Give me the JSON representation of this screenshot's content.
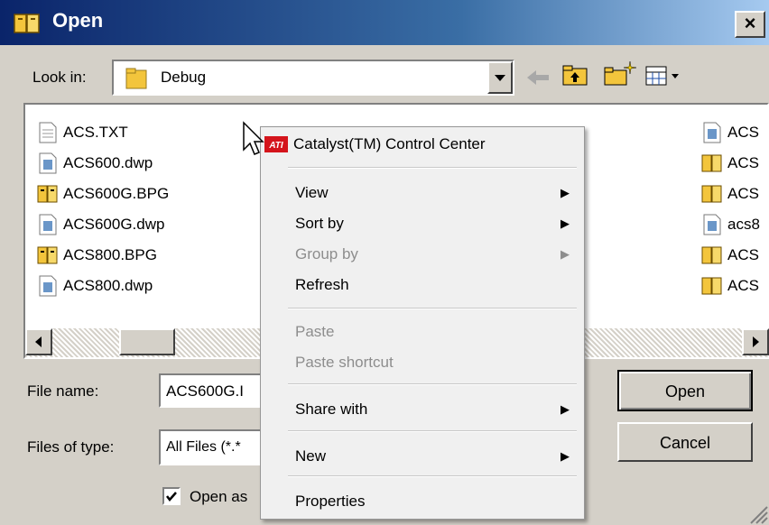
{
  "window": {
    "title": "Open",
    "close_label": "×"
  },
  "lookin": {
    "label": "Look in:",
    "value": "Debug"
  },
  "files_left": [
    {
      "name": "ACS.TXT",
      "icon": "text-file-icon"
    },
    {
      "name": "ACS600.dwp",
      "icon": "dwp-file-icon"
    },
    {
      "name": "ACS600G.BPG",
      "icon": "bpg-file-icon"
    },
    {
      "name": "ACS600G.dwp",
      "icon": "dwp-file-icon"
    },
    {
      "name": "ACS800.BPG",
      "icon": "bpg-file-icon"
    },
    {
      "name": "ACS800.dwp",
      "icon": "dwp-file-icon"
    }
  ],
  "files_right": [
    {
      "name": "ACS",
      "icon": "dwp-file-icon"
    },
    {
      "name": "ACS",
      "icon": "bpg-file-icon"
    },
    {
      "name": "ACS",
      "icon": "bpg-file-icon"
    },
    {
      "name": "acs8",
      "icon": "dwp-file-icon"
    },
    {
      "name": "ACS",
      "icon": "bpg-file-icon"
    },
    {
      "name": "ACS",
      "icon": "bpg-file-icon"
    }
  ],
  "form": {
    "filename_label": "File name:",
    "filename_value": "ACS600G.I",
    "filetype_label": "Files of type:",
    "filetype_value": "All Files (*.*",
    "readonly_label": "Open as",
    "readonly_checked": true
  },
  "buttons": {
    "open": "Open",
    "cancel": "Cancel"
  },
  "context_menu": {
    "header": "Catalyst(TM) Control Center",
    "view": "View",
    "sort_by": "Sort by",
    "group_by": "Group by",
    "refresh": "Refresh",
    "paste": "Paste",
    "paste_shortcut": "Paste shortcut",
    "share_with": "Share with",
    "new": "New",
    "properties": "Properties"
  },
  "colors": {
    "titlebar_start": "#0a246a",
    "titlebar_end": "#a6caf0",
    "ati_red": "#d4141b",
    "folder_yellow": "#f3c53c"
  }
}
